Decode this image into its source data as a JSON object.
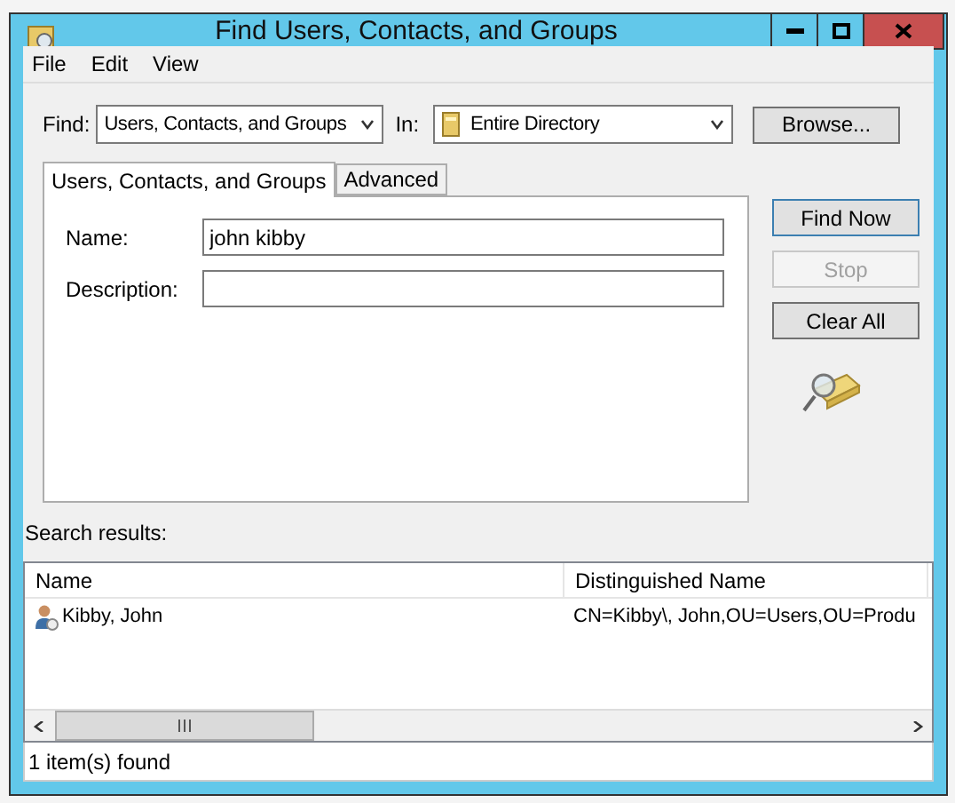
{
  "window": {
    "title": "Find Users, Contacts, and Groups"
  },
  "menu": [
    "File",
    "Edit",
    "View"
  ],
  "find": {
    "label": "Find:",
    "value": "Users, Contacts, and Groups"
  },
  "in": {
    "label": "In:",
    "value": "Entire Directory"
  },
  "browse_button": "Browse...",
  "tabs": [
    {
      "label": "Users, Contacts, and Groups",
      "selected": true
    },
    {
      "label": "Advanced",
      "selected": false
    }
  ],
  "fields": [
    {
      "label": "Name:",
      "value": "john kibby"
    },
    {
      "label": "Description:"
    }
  ],
  "buttons": [
    {
      "label": "Find Now",
      "disabled": false,
      "default": true
    },
    {
      "label": "Stop",
      "disabled": true,
      "default": false
    },
    {
      "label": "Clear All",
      "disabled": false,
      "default": false
    }
  ],
  "results_label": "Search results:",
  "table": {
    "columns": [
      "Name",
      "Distinguished Name"
    ],
    "rows": [
      {
        "name": "Kibby, John",
        "dn": "CN=Kibby\\, John,OU=Users,OU=Produ"
      }
    ]
  },
  "status_bar": "1 item(s) found"
}
